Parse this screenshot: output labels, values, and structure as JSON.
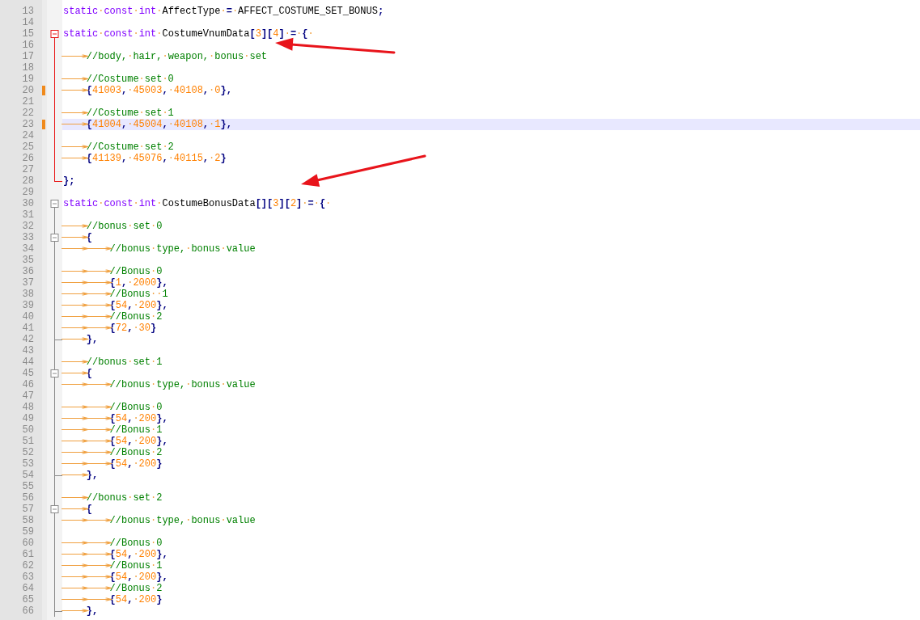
{
  "editor": {
    "lines": [
      {
        "no": "13",
        "changed": false,
        "current": false,
        "tokens": [
          {
            "kind": "kw",
            "text": "static·const·int·"
          },
          {
            "kind": "id",
            "text": "AffectType·"
          },
          {
            "kind": "op",
            "text": "=·"
          },
          {
            "kind": "id",
            "text": "AFFECT_COSTUME_SET_BONUS"
          },
          {
            "kind": "op",
            "text": ";"
          }
        ]
      },
      {
        "no": "14",
        "changed": false,
        "current": false
      },
      {
        "no": "15",
        "changed": false,
        "current": false,
        "fold": {
          "kind": "head",
          "active": true
        },
        "tokens": [
          {
            "kind": "kw",
            "text": "static·const·int·"
          },
          {
            "kind": "id",
            "text": "CostumeVnumData"
          },
          {
            "kind": "op",
            "text": "["
          },
          {
            "kind": "num",
            "text": "3"
          },
          {
            "kind": "op",
            "text": "]["
          },
          {
            "kind": "num",
            "text": "4"
          },
          {
            "kind": "op",
            "text": "]·=·{·"
          }
        ]
      },
      {
        "no": "16",
        "changed": false,
        "current": false,
        "fold": {
          "kind": "line",
          "active": true
        }
      },
      {
        "no": "17",
        "changed": false,
        "current": false,
        "fold": {
          "kind": "line",
          "active": true
        },
        "tokens": [
          {
            "kind": "cm",
            "text": "⟶//body,·hair,·weapon,·bonus·set"
          }
        ]
      },
      {
        "no": "18",
        "changed": false,
        "current": false,
        "fold": {
          "kind": "line",
          "active": true
        }
      },
      {
        "no": "19",
        "changed": false,
        "current": false,
        "fold": {
          "kind": "line",
          "active": true
        },
        "tokens": [
          {
            "kind": "cm",
            "text": "⟶//Costume·set·0"
          }
        ]
      },
      {
        "no": "20",
        "changed": true,
        "current": false,
        "fold": {
          "kind": "line",
          "active": true
        },
        "tokens": [
          {
            "kind": "op",
            "text": "⟶{"
          },
          {
            "kind": "num",
            "text": "41003"
          },
          {
            "kind": "op",
            "text": ",·"
          },
          {
            "kind": "num",
            "text": "45003"
          },
          {
            "kind": "op",
            "text": ",·"
          },
          {
            "kind": "num",
            "text": "40108"
          },
          {
            "kind": "op",
            "text": ",·"
          },
          {
            "kind": "num",
            "text": "0"
          },
          {
            "kind": "op",
            "text": "},"
          }
        ]
      },
      {
        "no": "21",
        "changed": false,
        "current": false,
        "fold": {
          "kind": "line",
          "active": true
        }
      },
      {
        "no": "22",
        "changed": false,
        "current": false,
        "fold": {
          "kind": "line",
          "active": true
        },
        "tokens": [
          {
            "kind": "cm",
            "text": "⟶//Costume·set·1"
          }
        ]
      },
      {
        "no": "23",
        "changed": true,
        "current": true,
        "fold": {
          "kind": "line",
          "active": true
        },
        "tokens": [
          {
            "kind": "op",
            "text": "⟶{"
          },
          {
            "kind": "num",
            "text": "41004"
          },
          {
            "kind": "op",
            "text": ",·"
          },
          {
            "kind": "num",
            "text": "45004"
          },
          {
            "kind": "op",
            "text": ",·"
          },
          {
            "kind": "num",
            "text": "40108"
          },
          {
            "kind": "op",
            "text": ",·"
          },
          {
            "kind": "num",
            "text": "1"
          },
          {
            "kind": "op",
            "text": "},"
          }
        ]
      },
      {
        "no": "24",
        "changed": false,
        "current": false,
        "fold": {
          "kind": "line",
          "active": true
        }
      },
      {
        "no": "25",
        "changed": false,
        "current": false,
        "fold": {
          "kind": "line",
          "active": true
        },
        "tokens": [
          {
            "kind": "cm",
            "text": "⟶//Costume·set·2"
          }
        ]
      },
      {
        "no": "26",
        "changed": false,
        "current": false,
        "fold": {
          "kind": "line",
          "active": true
        },
        "tokens": [
          {
            "kind": "op",
            "text": "⟶{"
          },
          {
            "kind": "num",
            "text": "41139"
          },
          {
            "kind": "op",
            "text": ",·"
          },
          {
            "kind": "num",
            "text": "45076"
          },
          {
            "kind": "op",
            "text": ",·"
          },
          {
            "kind": "num",
            "text": "40115"
          },
          {
            "kind": "op",
            "text": ",·"
          },
          {
            "kind": "num",
            "text": "2"
          },
          {
            "kind": "op",
            "text": "}"
          }
        ]
      },
      {
        "no": "27",
        "changed": false,
        "current": false,
        "fold": {
          "kind": "line",
          "active": true
        }
      },
      {
        "no": "28",
        "changed": false,
        "current": false,
        "fold": {
          "kind": "end",
          "active": true
        },
        "tokens": [
          {
            "kind": "op",
            "text": "};"
          }
        ]
      },
      {
        "no": "29",
        "changed": false,
        "current": false
      },
      {
        "no": "30",
        "changed": false,
        "current": false,
        "fold": {
          "kind": "head",
          "active": false
        },
        "tokens": [
          {
            "kind": "kw",
            "text": "static·const·int·"
          },
          {
            "kind": "id",
            "text": "CostumeBonusData"
          },
          {
            "kind": "op",
            "text": "[]["
          },
          {
            "kind": "num",
            "text": "3"
          },
          {
            "kind": "op",
            "text": "]["
          },
          {
            "kind": "num",
            "text": "2"
          },
          {
            "kind": "op",
            "text": "]·=·{·"
          }
        ]
      },
      {
        "no": "31",
        "changed": false,
        "current": false,
        "fold": {
          "kind": "line",
          "active": false
        }
      },
      {
        "no": "32",
        "changed": false,
        "current": false,
        "fold": {
          "kind": "line",
          "active": false
        },
        "tokens": [
          {
            "kind": "cm",
            "text": "⟶//bonus·set·0"
          }
        ]
      },
      {
        "no": "33",
        "changed": false,
        "current": false,
        "fold": {
          "kind": "inner-head",
          "active": false
        },
        "tokens": [
          {
            "kind": "op",
            "text": "⟶{"
          }
        ]
      },
      {
        "no": "34",
        "changed": false,
        "current": false,
        "fold": {
          "kind": "line",
          "active": false
        },
        "tokens": [
          {
            "kind": "cm",
            "text": "⟶⟶//bonus·type,·bonus·value"
          }
        ]
      },
      {
        "no": "35",
        "changed": false,
        "current": false,
        "fold": {
          "kind": "line",
          "active": false
        }
      },
      {
        "no": "36",
        "changed": false,
        "current": false,
        "fold": {
          "kind": "line",
          "active": false
        },
        "tokens": [
          {
            "kind": "cm",
            "text": "⟶⟶//Bonus·0"
          }
        ]
      },
      {
        "no": "37",
        "changed": false,
        "current": false,
        "fold": {
          "kind": "line",
          "active": false
        },
        "tokens": [
          {
            "kind": "op",
            "text": "⟶⟶{"
          },
          {
            "kind": "num",
            "text": "1"
          },
          {
            "kind": "op",
            "text": ",·"
          },
          {
            "kind": "num",
            "text": "2000"
          },
          {
            "kind": "op",
            "text": "},"
          }
        ]
      },
      {
        "no": "38",
        "changed": false,
        "current": false,
        "fold": {
          "kind": "line",
          "active": false
        },
        "tokens": [
          {
            "kind": "cm",
            "text": "⟶⟶//Bonus··1"
          }
        ]
      },
      {
        "no": "39",
        "changed": false,
        "current": false,
        "fold": {
          "kind": "line",
          "active": false
        },
        "tokens": [
          {
            "kind": "op",
            "text": "⟶⟶{"
          },
          {
            "kind": "num",
            "text": "54"
          },
          {
            "kind": "op",
            "text": ",·"
          },
          {
            "kind": "num",
            "text": "200"
          },
          {
            "kind": "op",
            "text": "},"
          }
        ]
      },
      {
        "no": "40",
        "changed": false,
        "current": false,
        "fold": {
          "kind": "line",
          "active": false
        },
        "tokens": [
          {
            "kind": "cm",
            "text": "⟶⟶//Bonus·2"
          }
        ]
      },
      {
        "no": "41",
        "changed": false,
        "current": false,
        "fold": {
          "kind": "line",
          "active": false
        },
        "tokens": [
          {
            "kind": "op",
            "text": "⟶⟶{"
          },
          {
            "kind": "num",
            "text": "72"
          },
          {
            "kind": "op",
            "text": ",·"
          },
          {
            "kind": "num",
            "text": "30"
          },
          {
            "kind": "op",
            "text": "}"
          }
        ]
      },
      {
        "no": "42",
        "changed": false,
        "current": false,
        "fold": {
          "kind": "branch",
          "active": false
        },
        "tokens": [
          {
            "kind": "op",
            "text": "⟶},"
          }
        ]
      },
      {
        "no": "43",
        "changed": false,
        "current": false,
        "fold": {
          "kind": "line",
          "active": false
        }
      },
      {
        "no": "44",
        "changed": false,
        "current": false,
        "fold": {
          "kind": "line",
          "active": false
        },
        "tokens": [
          {
            "kind": "cm",
            "text": "⟶//bonus·set·1"
          }
        ]
      },
      {
        "no": "45",
        "changed": false,
        "current": false,
        "fold": {
          "kind": "inner-head",
          "active": false
        },
        "tokens": [
          {
            "kind": "op",
            "text": "⟶{"
          }
        ]
      },
      {
        "no": "46",
        "changed": false,
        "current": false,
        "fold": {
          "kind": "line",
          "active": false
        },
        "tokens": [
          {
            "kind": "cm",
            "text": "⟶⟶//bonus·type,·bonus·value"
          }
        ]
      },
      {
        "no": "47",
        "changed": false,
        "current": false,
        "fold": {
          "kind": "line",
          "active": false
        }
      },
      {
        "no": "48",
        "changed": false,
        "current": false,
        "fold": {
          "kind": "line",
          "active": false
        },
        "tokens": [
          {
            "kind": "cm",
            "text": "⟶⟶//Bonus·0"
          }
        ]
      },
      {
        "no": "49",
        "changed": false,
        "current": false,
        "fold": {
          "kind": "line",
          "active": false
        },
        "tokens": [
          {
            "kind": "op",
            "text": "⟶⟶{"
          },
          {
            "kind": "num",
            "text": "54"
          },
          {
            "kind": "op",
            "text": ",·"
          },
          {
            "kind": "num",
            "text": "200"
          },
          {
            "kind": "op",
            "text": "},"
          }
        ]
      },
      {
        "no": "50",
        "changed": false,
        "current": false,
        "fold": {
          "kind": "line",
          "active": false
        },
        "tokens": [
          {
            "kind": "cm",
            "text": "⟶⟶//Bonus·1"
          }
        ]
      },
      {
        "no": "51",
        "changed": false,
        "current": false,
        "fold": {
          "kind": "line",
          "active": false
        },
        "tokens": [
          {
            "kind": "op",
            "text": "⟶⟶{"
          },
          {
            "kind": "num",
            "text": "54"
          },
          {
            "kind": "op",
            "text": ",·"
          },
          {
            "kind": "num",
            "text": "200"
          },
          {
            "kind": "op",
            "text": "},"
          }
        ]
      },
      {
        "no": "52",
        "changed": false,
        "current": false,
        "fold": {
          "kind": "line",
          "active": false
        },
        "tokens": [
          {
            "kind": "cm",
            "text": "⟶⟶//Bonus·2"
          }
        ]
      },
      {
        "no": "53",
        "changed": false,
        "current": false,
        "fold": {
          "kind": "line",
          "active": false
        },
        "tokens": [
          {
            "kind": "op",
            "text": "⟶⟶{"
          },
          {
            "kind": "num",
            "text": "54"
          },
          {
            "kind": "op",
            "text": ",·"
          },
          {
            "kind": "num",
            "text": "200"
          },
          {
            "kind": "op",
            "text": "}"
          }
        ]
      },
      {
        "no": "54",
        "changed": false,
        "current": false,
        "fold": {
          "kind": "branch",
          "active": false
        },
        "tokens": [
          {
            "kind": "op",
            "text": "⟶},"
          }
        ]
      },
      {
        "no": "55",
        "changed": false,
        "current": false,
        "fold": {
          "kind": "line",
          "active": false
        }
      },
      {
        "no": "56",
        "changed": false,
        "current": false,
        "fold": {
          "kind": "line",
          "active": false
        },
        "tokens": [
          {
            "kind": "cm",
            "text": "⟶//bonus·set·2"
          }
        ]
      },
      {
        "no": "57",
        "changed": false,
        "current": false,
        "fold": {
          "kind": "inner-head",
          "active": false
        },
        "tokens": [
          {
            "kind": "op",
            "text": "⟶{"
          }
        ]
      },
      {
        "no": "58",
        "changed": false,
        "current": false,
        "fold": {
          "kind": "line",
          "active": false
        },
        "tokens": [
          {
            "kind": "cm",
            "text": "⟶⟶//bonus·type,·bonus·value"
          }
        ]
      },
      {
        "no": "59",
        "changed": false,
        "current": false,
        "fold": {
          "kind": "line",
          "active": false
        }
      },
      {
        "no": "60",
        "changed": false,
        "current": false,
        "fold": {
          "kind": "line",
          "active": false
        },
        "tokens": [
          {
            "kind": "cm",
            "text": "⟶⟶//Bonus·0"
          }
        ]
      },
      {
        "no": "61",
        "changed": false,
        "current": false,
        "fold": {
          "kind": "line",
          "active": false
        },
        "tokens": [
          {
            "kind": "op",
            "text": "⟶⟶{"
          },
          {
            "kind": "num",
            "text": "54"
          },
          {
            "kind": "op",
            "text": ",·"
          },
          {
            "kind": "num",
            "text": "200"
          },
          {
            "kind": "op",
            "text": "},"
          }
        ]
      },
      {
        "no": "62",
        "changed": false,
        "current": false,
        "fold": {
          "kind": "line",
          "active": false
        },
        "tokens": [
          {
            "kind": "cm",
            "text": "⟶⟶//Bonus·1"
          }
        ]
      },
      {
        "no": "63",
        "changed": false,
        "current": false,
        "fold": {
          "kind": "line",
          "active": false
        },
        "tokens": [
          {
            "kind": "op",
            "text": "⟶⟶{"
          },
          {
            "kind": "num",
            "text": "54"
          },
          {
            "kind": "op",
            "text": ",·"
          },
          {
            "kind": "num",
            "text": "200"
          },
          {
            "kind": "op",
            "text": "},"
          }
        ]
      },
      {
        "no": "64",
        "changed": false,
        "current": false,
        "fold": {
          "kind": "line",
          "active": false
        },
        "tokens": [
          {
            "kind": "cm",
            "text": "⟶⟶//Bonus·2"
          }
        ]
      },
      {
        "no": "65",
        "changed": false,
        "current": false,
        "fold": {
          "kind": "line",
          "active": false
        },
        "tokens": [
          {
            "kind": "op",
            "text": "⟶⟶{"
          },
          {
            "kind": "num",
            "text": "54"
          },
          {
            "kind": "op",
            "text": ",·"
          },
          {
            "kind": "num",
            "text": "200"
          },
          {
            "kind": "op",
            "text": "}"
          }
        ]
      },
      {
        "no": "66",
        "changed": false,
        "current": false,
        "fold": {
          "kind": "branch",
          "active": false
        },
        "tokens": [
          {
            "kind": "op",
            "text": "⟶},"
          }
        ]
      }
    ]
  }
}
